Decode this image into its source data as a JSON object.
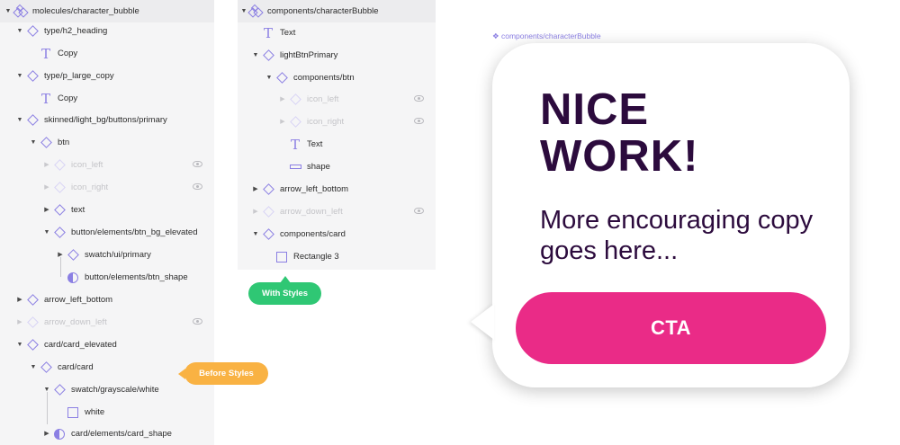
{
  "left_tree": {
    "root": "molecules/character_bubble",
    "h2_heading": "type/h2_heading",
    "h2_copy": "Copy",
    "p_large_copy": "type/p_large_copy",
    "p_copy": "Copy",
    "button_primary": "skinned/light_bg/buttons/primary",
    "btn": "btn",
    "icon_left": "icon_left",
    "icon_right": "icon_right",
    "text": "text",
    "btn_bg_elevated": "button/elements/btn_bg_elevated",
    "swatch_primary": "swatch/ui/primary",
    "btn_shape": "button/elements/btn_shape",
    "arrow_left_bottom": "arrow_left_bottom",
    "arrow_down_left": "arrow_down_left",
    "card_elevated": "card/card_elevated",
    "card": "card/card",
    "swatch_white": "swatch/grayscale/white",
    "white": "white",
    "card_shape": "card/elements/card_shape"
  },
  "mid_tree": {
    "root": "components/characterBubble",
    "text": "Text",
    "light_btn_primary": "lightBtnPrimary",
    "components_btn": "components/btn",
    "icon_left": "icon_left",
    "icon_right": "icon_right",
    "btn_text": "Text",
    "shape": "shape",
    "arrow_left_bottom": "arrow_left_bottom",
    "arrow_down_left": "arrow_down_left",
    "components_card": "components/card",
    "rectangle": "Rectangle 3"
  },
  "badges": {
    "before": "Before Styles",
    "with": "With Styles"
  },
  "preview": {
    "label": "❖ components/characterBubble",
    "heading": "NICE WORK!",
    "copy": "More encouraging copy goes here...",
    "cta": "CTA"
  },
  "colors": {
    "accent": "#8b7fe3",
    "heading": "#2c0b3d",
    "cta": "#ea2b87",
    "before_badge": "#f9b243",
    "with_badge": "#2fc774"
  }
}
